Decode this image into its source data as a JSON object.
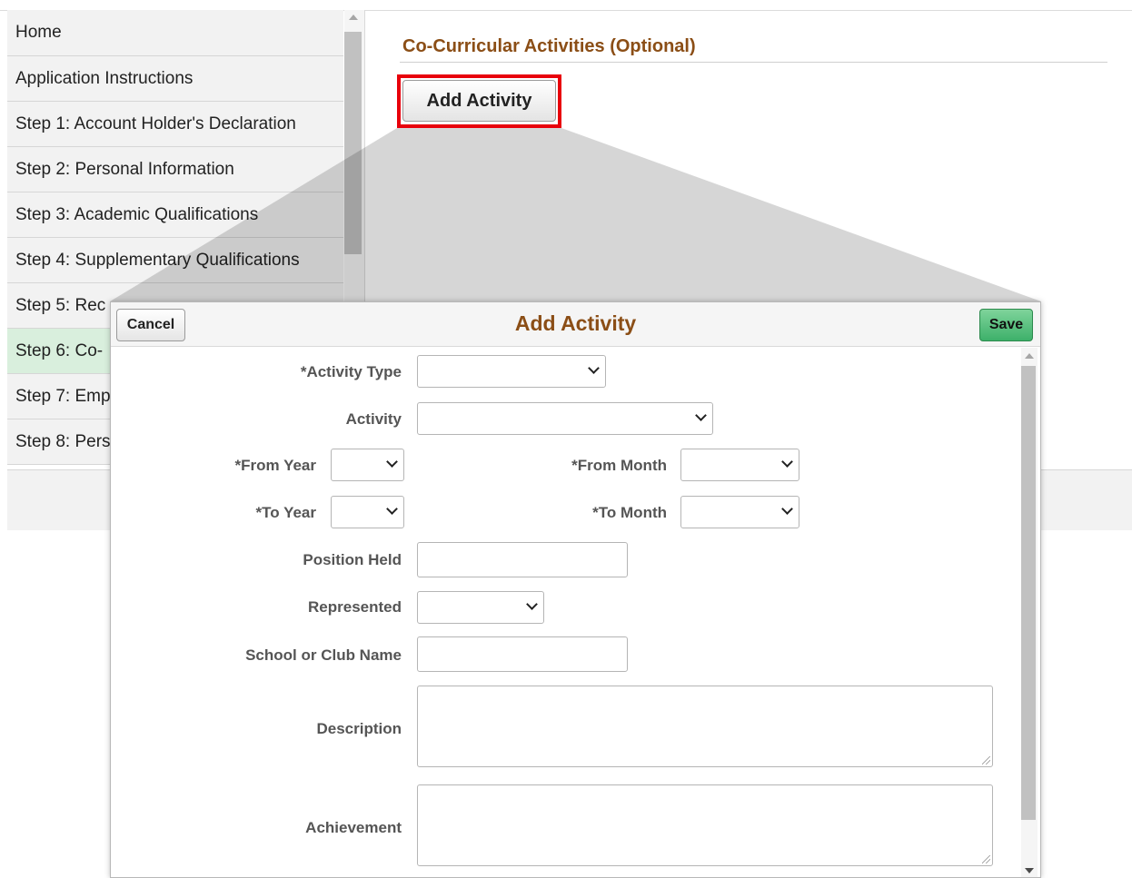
{
  "sidebar": {
    "items": [
      {
        "label": "Home"
      },
      {
        "label": "Application Instructions"
      },
      {
        "label": "Step 1: Account Holder's Declaration"
      },
      {
        "label": "Step 2: Personal Information"
      },
      {
        "label": "Step 3: Academic Qualifications"
      },
      {
        "label": "Step 4: Supplementary Qualifications"
      },
      {
        "label": "Step 5: Rec"
      },
      {
        "label": "Step 6: Co-",
        "active": true
      },
      {
        "label": "Step 7: Emp"
      },
      {
        "label": "Step 8: Pers"
      }
    ]
  },
  "main": {
    "section_title": "Co-Curricular Activities (Optional)",
    "add_button_label": "Add Activity"
  },
  "modal": {
    "title": "Add Activity",
    "cancel_label": "Cancel",
    "save_label": "Save",
    "fields": {
      "activity_type": {
        "label": "*Activity Type",
        "value": ""
      },
      "activity": {
        "label": "Activity",
        "value": ""
      },
      "from_year": {
        "label": "*From Year",
        "value": ""
      },
      "from_month": {
        "label": "*From Month",
        "value": ""
      },
      "to_year": {
        "label": "*To Year",
        "value": ""
      },
      "to_month": {
        "label": "*To Month",
        "value": ""
      },
      "position_held": {
        "label": "Position Held",
        "value": ""
      },
      "represented": {
        "label": "Represented",
        "value": ""
      },
      "school_or_club_name": {
        "label": "School or Club Name",
        "value": ""
      },
      "description": {
        "label": "Description",
        "value": ""
      },
      "achievement": {
        "label": "Achievement",
        "value": ""
      }
    }
  },
  "colors": {
    "title_brown": "#8b4e16",
    "highlight_red": "#e8000b",
    "save_green": "#3db06a",
    "active_nav": "#d9efdd"
  }
}
